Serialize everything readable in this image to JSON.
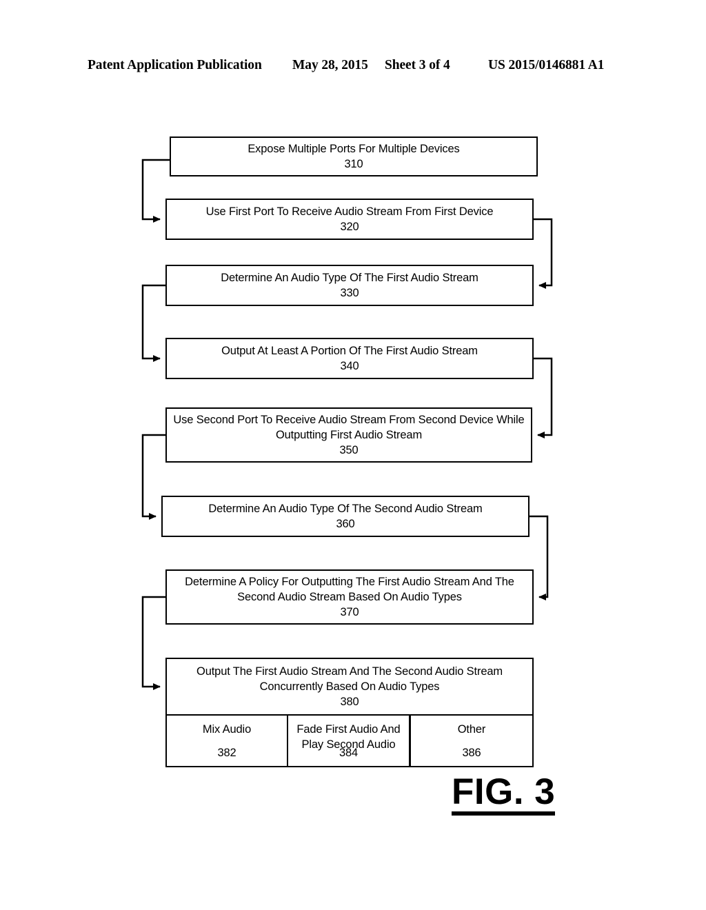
{
  "header": {
    "publication": "Patent Application Publication",
    "date": "May 28, 2015",
    "sheet": "Sheet 3 of 4",
    "patent_number": "US 2015/0146881 A1"
  },
  "figure": {
    "caption": "FIG. 3",
    "type": "flowchart",
    "line_color": "#000000",
    "background_color": "#ffffff"
  },
  "flowchart": {
    "steps": [
      {
        "id": "310",
        "text": "Expose Multiple Ports For Multiple Devices",
        "number": "310"
      },
      {
        "id": "320",
        "text": "Use First Port To Receive Audio Stream From First Device",
        "number": "320"
      },
      {
        "id": "330",
        "text": "Determine An Audio Type Of The First Audio Stream",
        "number": "330"
      },
      {
        "id": "340",
        "text": "Output At Least A Portion Of The First Audio Stream",
        "number": "340"
      },
      {
        "id": "350",
        "text_line1": "Use Second Port To Receive Audio Stream From Second Device While",
        "text_line2": "Outputting First Audio Stream",
        "number": "350"
      },
      {
        "id": "360",
        "text": "Determine An Audio Type Of The Second Audio Stream",
        "number": "360"
      },
      {
        "id": "370",
        "text_line1": "Determine A Policy For Outputting The First Audio Stream And The",
        "text_line2": "Second Audio Stream Based On Audio Types",
        "number": "370"
      },
      {
        "id": "380",
        "text_line1": "Output The First Audio Stream And The Second Audio Stream",
        "text_line2": "Concurrently Based On Audio Types",
        "number": "380"
      }
    ],
    "sub_steps": [
      {
        "id": "382",
        "text_line1": "Mix Audio",
        "text_line2": "",
        "number": "382"
      },
      {
        "id": "384",
        "text_line1": "Fade First Audio And",
        "text_line2": "Play Second Audio",
        "number": "384"
      },
      {
        "id": "386",
        "text_line1": "Other",
        "text_line2": "",
        "number": "386"
      }
    ]
  }
}
